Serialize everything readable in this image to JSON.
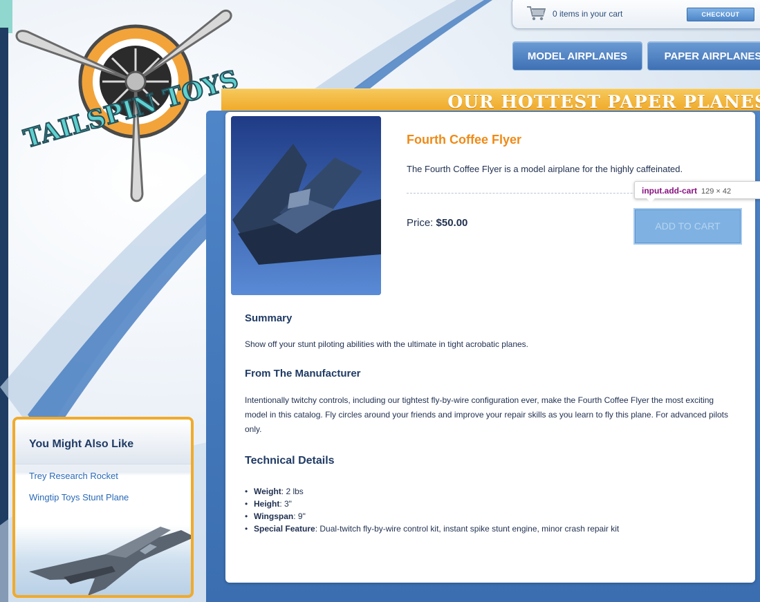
{
  "brand": {
    "logo_text": "TAILSPIN TOYS"
  },
  "cart": {
    "status": "0 items in your cart",
    "checkout_label": "CHECKOUT"
  },
  "nav": {
    "tabs": [
      {
        "label": "MODEL AIRPLANES"
      },
      {
        "label": "PAPER AIRPLANES"
      }
    ]
  },
  "banner": {
    "title": "OUR HOTTEST PAPER PLANES"
  },
  "product": {
    "name": "Fourth Coffee Flyer",
    "description": "The Fourth Coffee Flyer is a model airplane for the highly caffeinated.",
    "price_label": "Price:",
    "price": "$50.00",
    "add_to_cart_label": "ADD TO CART"
  },
  "devtools_tooltip": {
    "tag": "input",
    "class": ".add-cart",
    "dimensions": "129 × 42"
  },
  "sections": {
    "summary_title": "Summary",
    "summary_text": "Show off your stunt piloting abilities with the ultimate in tight acrobatic planes.",
    "manufacturer_title": "From The Manufacturer",
    "manufacturer_text": "Intentionally twitchy controls, including our tightest fly-by-wire configuration ever, make the Fourth Coffee Flyer the most exciting model in this catalog. Fly circles around your friends and improve your repair skills as you learn to fly this plane. For advanced pilots only.",
    "technical_title": "Technical Details",
    "specs": [
      {
        "label": "Weight",
        "value": ": 2 lbs"
      },
      {
        "label": "Height",
        "value": ": 3\""
      },
      {
        "label": "Wingspan",
        "value": ": 9\""
      },
      {
        "label": "Special Feature",
        "value": ": Dual-twitch fly-by-wire control kit, instant spike stunt engine, minor crash repair kit"
      }
    ]
  },
  "sidebar": {
    "title": "You Might Also Like",
    "links": [
      {
        "label": "Trey Research Rocket"
      },
      {
        "label": "Wingtip Toys Stunt Plane"
      }
    ]
  },
  "colors": {
    "accent_orange": "#ef8a16",
    "nav_blue": "#3e70b4",
    "banner_gold": "#f1aa2a"
  }
}
